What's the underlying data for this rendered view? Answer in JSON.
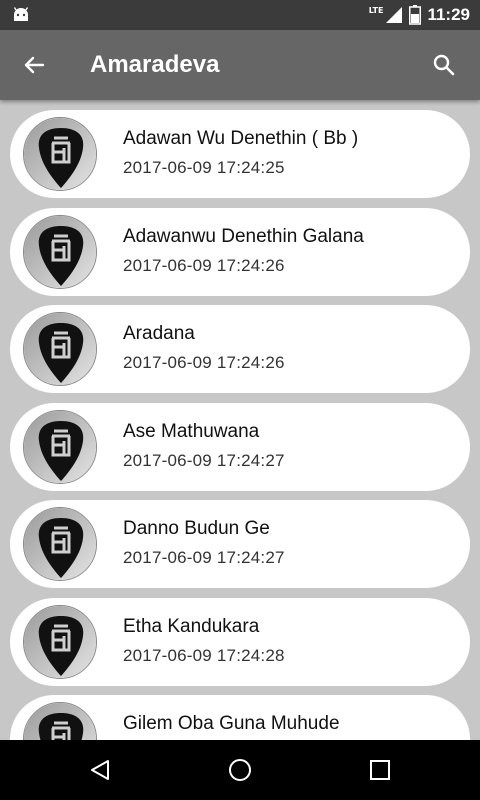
{
  "status_bar": {
    "network_label": "LTE",
    "time": "11:29"
  },
  "app_bar": {
    "title": "Amaradeva"
  },
  "songs": [
    {
      "name": "Adawan Wu Denethin ( Bb )",
      "date": "2017-06-09 17:24:25"
    },
    {
      "name": "Adawanwu Denethin Galana",
      "date": "2017-06-09 17:24:26"
    },
    {
      "name": "Aradana",
      "date": "2017-06-09 17:24:26"
    },
    {
      "name": "Ase Mathuwana",
      "date": "2017-06-09 17:24:27"
    },
    {
      "name": "Danno Budun Ge",
      "date": "2017-06-09 17:24:27"
    },
    {
      "name": "Etha Kandukara",
      "date": "2017-06-09 17:24:28"
    },
    {
      "name": "Gilem Oba Guna Muhude",
      "date": ""
    }
  ],
  "icons": {
    "status": [
      "android-icon",
      "lte-signal-icon",
      "battery-icon"
    ],
    "app_bar": [
      "back-arrow-icon",
      "search-icon"
    ],
    "list_item": "guitar-pick-logo-icon",
    "navigation": [
      "nav-back-icon",
      "nav-home-icon",
      "nav-recents-icon"
    ]
  },
  "colors": {
    "status_bar": "#3b3b3b",
    "app_bar": "#666666",
    "list_background": "#c7c7c7",
    "card": "#ffffff",
    "nav_bar": "#000000"
  }
}
